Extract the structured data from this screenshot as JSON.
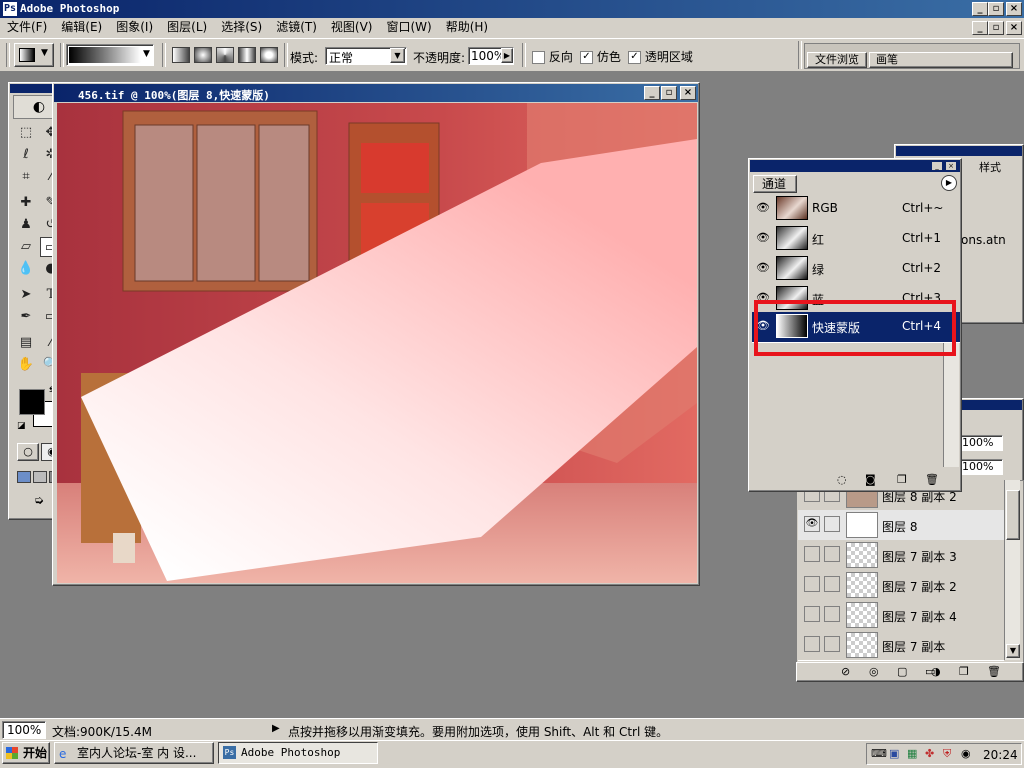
{
  "app": {
    "title": "Adobe Photoshop"
  },
  "menu": [
    "文件(F)",
    "编辑(E)",
    "图象(I)",
    "图层(L)",
    "选择(S)",
    "滤镜(T)",
    "视图(V)",
    "窗口(W)",
    "帮助(H)"
  ],
  "options": {
    "mode_label": "模式:",
    "mode_value": "正常",
    "opacity_label": "不透明度:",
    "opacity_value": "100%",
    "reverse_label": "反向",
    "dither_label": "仿色",
    "transparency_label": "透明区域",
    "reverse_checked": false,
    "dither_checked": true,
    "transparency_checked": true
  },
  "palette_well": {
    "tab1": "文件浏览",
    "tab2": "画笔"
  },
  "document": {
    "title": "456.tif @ 100%(图层 8,快速蒙版)"
  },
  "channels": {
    "tab": "通道",
    "rows": [
      {
        "name": "RGB",
        "shortcut": "Ctrl+~"
      },
      {
        "name": "红",
        "shortcut": "Ctrl+1"
      },
      {
        "name": "绿",
        "shortcut": "Ctrl+2"
      },
      {
        "name": "蓝",
        "shortcut": "Ctrl+3"
      },
      {
        "name": "快速蒙版",
        "shortcut": "Ctrl+4"
      }
    ]
  },
  "back_panel": {
    "tab": "样式",
    "actions_file": "ons.atn"
  },
  "layers": {
    "opacity": "100%",
    "fill": "100%",
    "rows": [
      {
        "name": "图层 8 副本 2"
      },
      {
        "name": "图层 8"
      },
      {
        "name": "图层 7 副本 3"
      },
      {
        "name": "图层 7 副本 2"
      },
      {
        "name": "图层 7 副本 4"
      },
      {
        "name": "图层 7 副本"
      }
    ]
  },
  "status": {
    "zoom": "100%",
    "doc": "文档:900K/15.4M",
    "hint": "点按并拖移以用渐变填充。要用附加选项，使用 Shift、Alt 和 Ctrl 键。"
  },
  "taskbar": {
    "start": "开始",
    "task1": "室内人论坛-室 内 设...",
    "task2": "Adobe Photoshop",
    "clock": "20:24"
  },
  "colors": {
    "highlight_box": "#e8141c",
    "selection": "#0a246a"
  }
}
